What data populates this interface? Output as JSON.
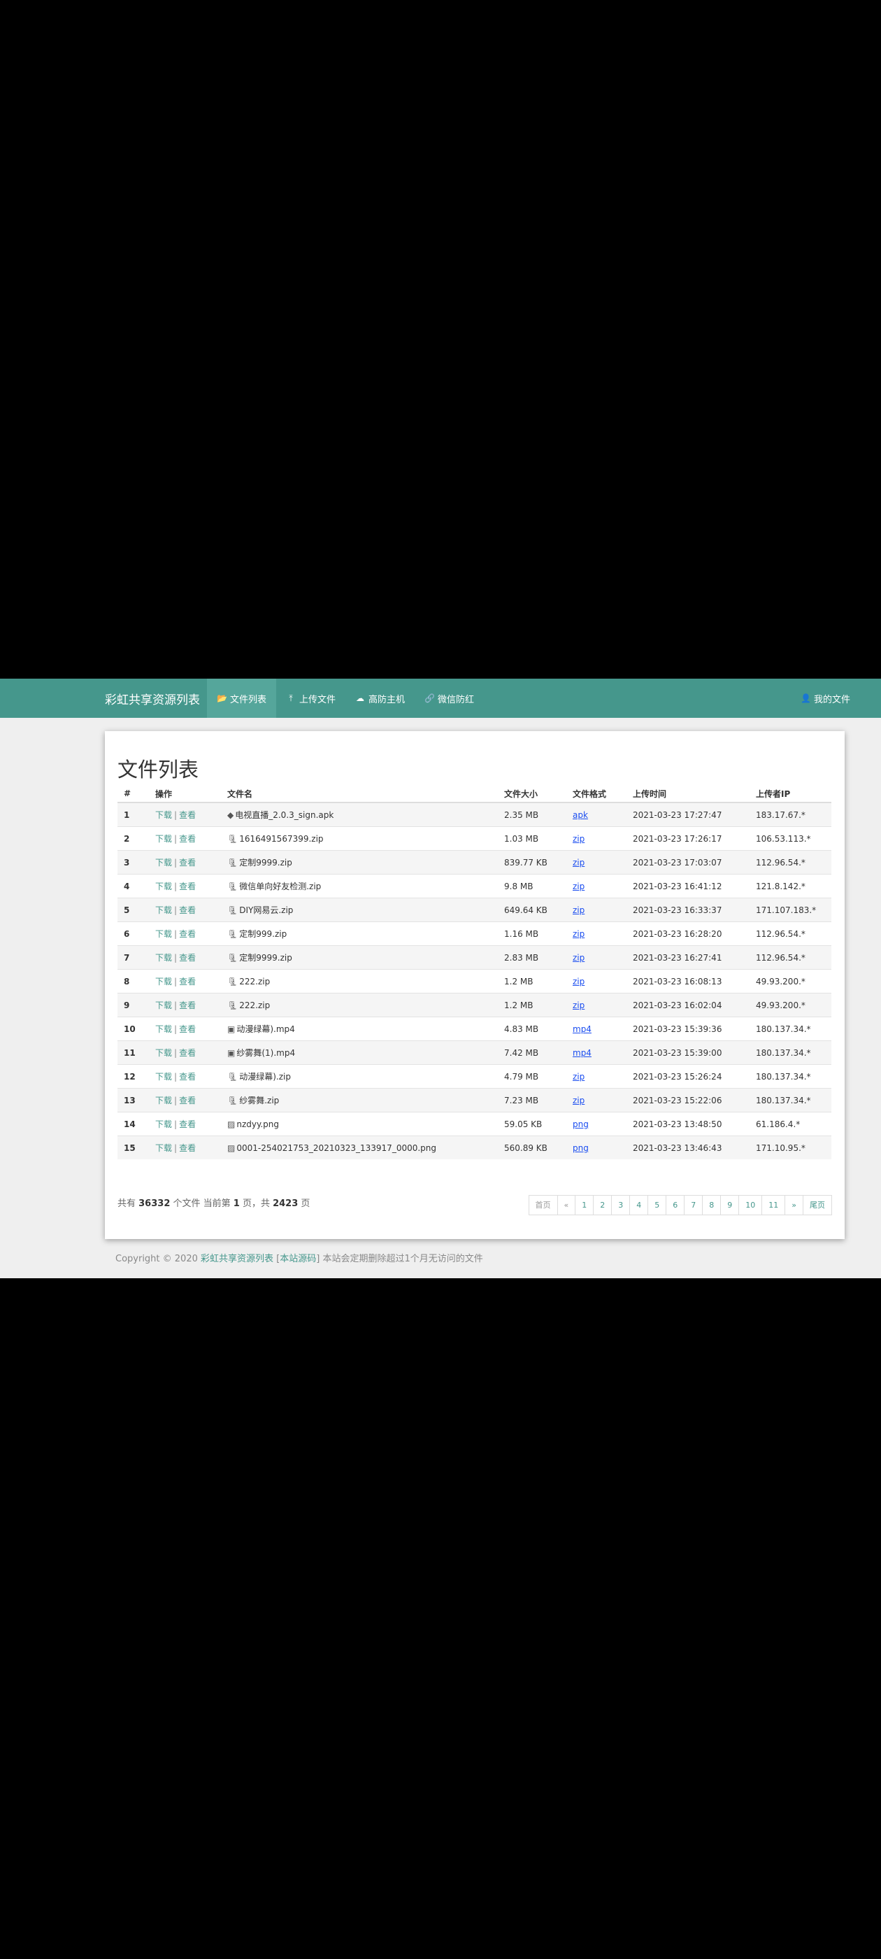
{
  "navbar": {
    "brand": "彩虹共享资源列表",
    "items": [
      {
        "label": "文件列表",
        "icon": "folder-open-icon",
        "glyph": "📂"
      },
      {
        "label": "上传文件",
        "icon": "upload-icon",
        "glyph": "⤒"
      },
      {
        "label": "高防主机",
        "icon": "cloud-icon",
        "glyph": "☁"
      },
      {
        "label": "微信防红",
        "icon": "link-icon",
        "glyph": "🔗"
      }
    ],
    "my_files": {
      "label": "我的文件",
      "icon": "user-icon",
      "glyph": "👤"
    }
  },
  "panel": {
    "title": "文件列表",
    "columns": [
      "#",
      "操作",
      "文件名",
      "文件大小",
      "文件格式",
      "上传时间",
      "上传者IP"
    ],
    "download_label": "下载",
    "view_label": "查看",
    "separator": "|",
    "rows": [
      {
        "num": "1",
        "name": "电视直播_2.0.3_sign.apk",
        "icon": "android-icon",
        "size": "2.35 MB",
        "format": "apk",
        "time": "2021-03-23 17:27:47",
        "ip": "183.17.67.*"
      },
      {
        "num": "2",
        "name": "1616491567399.zip",
        "icon": "file-archive-icon",
        "size": "1.03 MB",
        "format": "zip",
        "time": "2021-03-23 17:26:17",
        "ip": "106.53.113.*"
      },
      {
        "num": "3",
        "name": "定制9999.zip",
        "icon": "file-archive-icon",
        "size": "839.77 KB",
        "format": "zip",
        "time": "2021-03-23 17:03:07",
        "ip": "112.96.54.*"
      },
      {
        "num": "4",
        "name": "微信单向好友检测.zip",
        "icon": "file-archive-icon",
        "size": "9.8 MB",
        "format": "zip",
        "time": "2021-03-23 16:41:12",
        "ip": "121.8.142.*"
      },
      {
        "num": "5",
        "name": "DIY网易云.zip",
        "icon": "file-archive-icon",
        "size": "649.64 KB",
        "format": "zip",
        "time": "2021-03-23 16:33:37",
        "ip": "171.107.183.*"
      },
      {
        "num": "6",
        "name": "定制999.zip",
        "icon": "file-archive-icon",
        "size": "1.16 MB",
        "format": "zip",
        "time": "2021-03-23 16:28:20",
        "ip": "112.96.54.*"
      },
      {
        "num": "7",
        "name": "定制9999.zip",
        "icon": "file-archive-icon",
        "size": "2.83 MB",
        "format": "zip",
        "time": "2021-03-23 16:27:41",
        "ip": "112.96.54.*"
      },
      {
        "num": "8",
        "name": "222.zip",
        "icon": "file-archive-icon",
        "size": "1.2 MB",
        "format": "zip",
        "time": "2021-03-23 16:08:13",
        "ip": "49.93.200.*"
      },
      {
        "num": "9",
        "name": "222.zip",
        "icon": "file-archive-icon",
        "size": "1.2 MB",
        "format": "zip",
        "time": "2021-03-23 16:02:04",
        "ip": "49.93.200.*"
      },
      {
        "num": "10",
        "name": "动漫绿幕).mp4",
        "icon": "file-video-icon",
        "size": "4.83 MB",
        "format": "mp4",
        "time": "2021-03-23 15:39:36",
        "ip": "180.137.34.*"
      },
      {
        "num": "11",
        "name": "纱雾舞(1).mp4",
        "icon": "file-video-icon",
        "size": "7.42 MB",
        "format": "mp4",
        "time": "2021-03-23 15:39:00",
        "ip": "180.137.34.*"
      },
      {
        "num": "12",
        "name": "动漫绿幕).zip",
        "icon": "file-archive-icon",
        "size": "4.79 MB",
        "format": "zip",
        "time": "2021-03-23 15:26:24",
        "ip": "180.137.34.*"
      },
      {
        "num": "13",
        "name": "纱雾舞.zip",
        "icon": "file-archive-icon",
        "size": "7.23 MB",
        "format": "zip",
        "time": "2021-03-23 15:22:06",
        "ip": "180.137.34.*"
      },
      {
        "num": "14",
        "name": "nzdyy.png",
        "icon": "file-image-icon",
        "size": "59.05 KB",
        "format": "png",
        "time": "2021-03-23 13:48:50",
        "ip": "61.186.4.*"
      },
      {
        "num": "15",
        "name": "0001-254021753_20210323_133917_0000.png",
        "icon": "file-image-icon",
        "size": "560.89 KB",
        "format": "png",
        "time": "2021-03-23 13:46:43",
        "ip": "171.10.95.*"
      }
    ],
    "summary": {
      "prefix": "共有 ",
      "total": "36332",
      "mid1": " 个文件  当前第 ",
      "current": "1",
      "mid2": " 页，共 ",
      "pages": "2423",
      "suffix": " 页"
    },
    "pagination": [
      "首页",
      "«",
      "1",
      "2",
      "3",
      "4",
      "5",
      "6",
      "7",
      "8",
      "9",
      "10",
      "11",
      "»",
      "尾页"
    ]
  },
  "footer": {
    "prefix": "Copyright © 2020 ",
    "site_link": "彩虹共享资源列表",
    "bracket_open": " [",
    "source_link": "本站源码",
    "suffix": "] 本站会定期删除超过1个月无访问的文件"
  },
  "colors": {
    "accent": "#45978c",
    "format_link": "#1a4df0"
  }
}
